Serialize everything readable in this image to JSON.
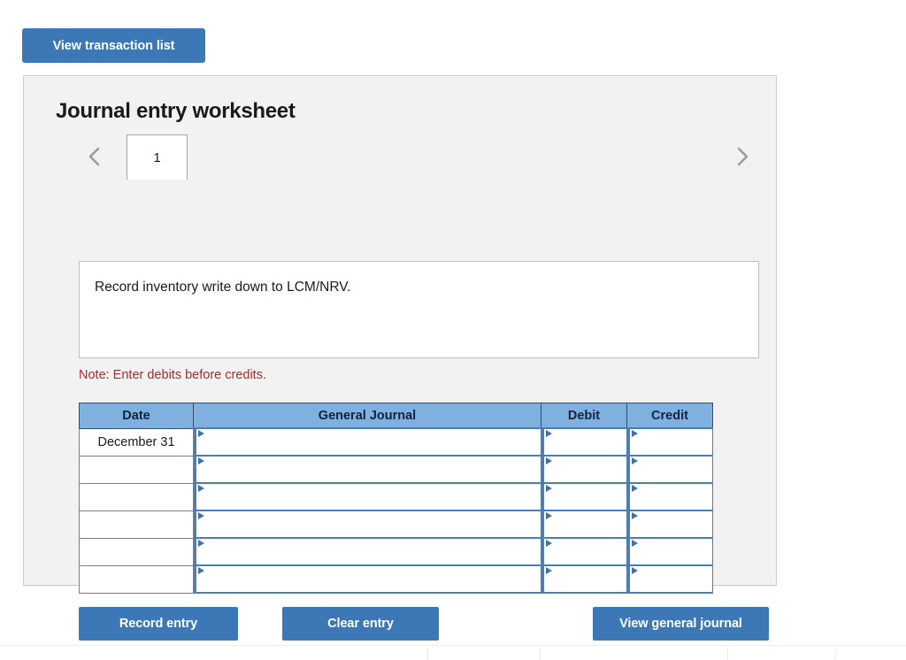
{
  "toolbar": {
    "view_transaction_list_label": "View transaction list"
  },
  "panel": {
    "title": "Journal entry worksheet",
    "pager": {
      "prev_icon": "chevron-left-icon",
      "next_icon": "chevron-right-icon",
      "tabs": [
        {
          "label": "1",
          "active": true
        }
      ]
    },
    "instruction": {
      "text": "Record inventory write down to LCM/NRV."
    },
    "note": "Note: Enter debits before credits.",
    "table": {
      "columns": [
        "Date",
        "General Journal",
        "Debit",
        "Credit"
      ],
      "rows": [
        {
          "date": "December 31",
          "general_journal": "",
          "debit": "",
          "credit": ""
        },
        {
          "date": "",
          "general_journal": "",
          "debit": "",
          "credit": ""
        },
        {
          "date": "",
          "general_journal": "",
          "debit": "",
          "credit": ""
        },
        {
          "date": "",
          "general_journal": "",
          "debit": "",
          "credit": ""
        },
        {
          "date": "",
          "general_journal": "",
          "debit": "",
          "credit": ""
        },
        {
          "date": "",
          "general_journal": "",
          "debit": "",
          "credit": ""
        }
      ]
    },
    "footer": {
      "record_entry_label": "Record entry",
      "clear_entry_label": "Clear entry",
      "view_general_journal_label": "View general journal"
    }
  },
  "colors": {
    "button_blue": "#3C78B5",
    "table_header_blue": "#7FB0DF",
    "cell_outline_blue": "#4A7EB5",
    "note_red": "#A82B2B",
    "panel_background": "#F2F2F2",
    "panel_border": "#CFCFCF"
  }
}
